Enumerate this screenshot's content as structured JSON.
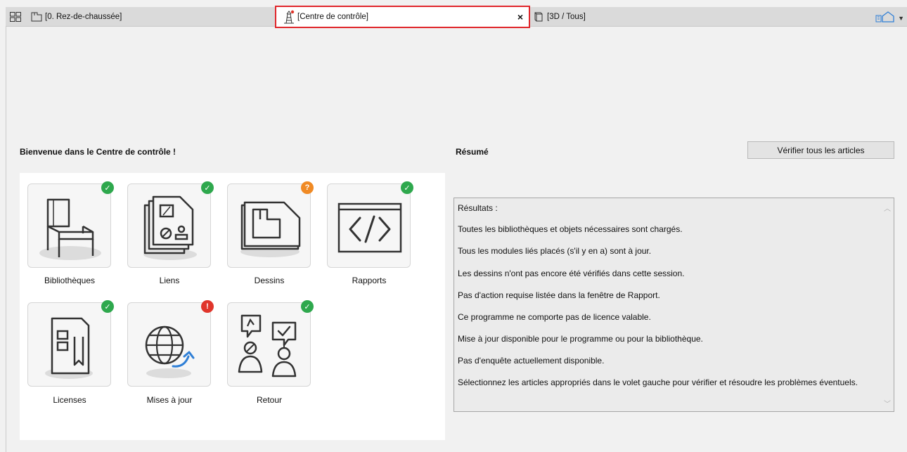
{
  "tabs": {
    "floor_label": "[0. Rez-de-chaussée]",
    "active_label": "[Centre de contrôle]",
    "close_label": "×",
    "view3d_label": "[3D / Tous]"
  },
  "main": {
    "welcome": "Bienvenue dans le Centre de contrôle !",
    "summary_title": "Résumé",
    "check_all_button": "Vérifier tous les articles"
  },
  "tiles": [
    {
      "label": "Bibliothèques",
      "status": "ok",
      "icon": "chair-icon"
    },
    {
      "label": "Liens",
      "status": "ok",
      "icon": "linked-modules-icon"
    },
    {
      "label": "Dessins",
      "status": "warning",
      "icon": "drawing-icon"
    },
    {
      "label": "Rapports",
      "status": "ok",
      "icon": "code-icon"
    },
    {
      "label": "Licenses",
      "status": "ok",
      "icon": "license-icon"
    },
    {
      "label": "Mises à jour",
      "status": "error",
      "icon": "globe-update-icon"
    },
    {
      "label": "Retour",
      "status": "ok",
      "icon": "feedback-icon"
    }
  ],
  "badges": {
    "ok": "✓",
    "warning": "?",
    "error": "!"
  },
  "results": {
    "heading": "Résultats :",
    "lines": [
      "Toutes les bibliothèques et objets nécessaires sont chargés.",
      "Tous les modules liés placés (s'il y en a) sont à jour.",
      "Les dessins n'ont pas encore été vérifiés dans cette session.",
      "Pas d'action requise listée dans la fenêtre de Rapport.",
      "Ce programme ne comporte pas de licence valable.",
      "Mise à jour disponible pour le programme ou pour la bibliothèque.",
      "Pas d'enquête actuellement disponible.",
      "Sélectionnez les articles appropriés dans le volet gauche pour vérifier et résoudre les problèmes éventuels."
    ]
  },
  "colors": {
    "ok": "#2ea84d",
    "warning": "#f08a24",
    "error": "#e0352b",
    "active_tab_border": "#e0262b",
    "accent_blue": "#2f7fd6"
  }
}
